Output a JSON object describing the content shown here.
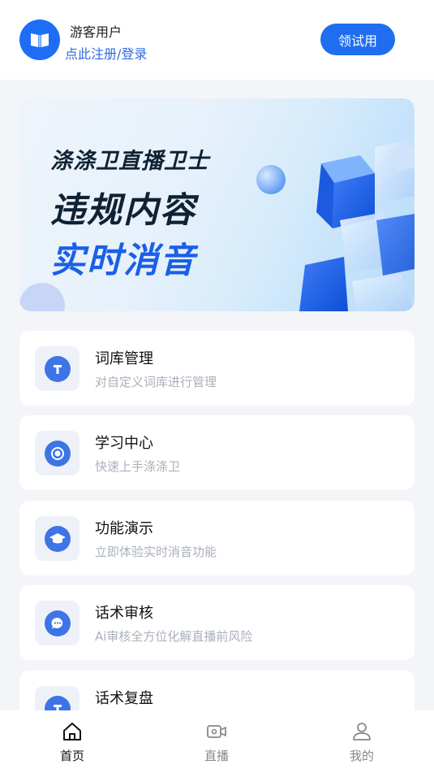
{
  "header": {
    "user_name": "游客用户",
    "login_link": "点此注册/登录",
    "trial_button": "领试用",
    "avatar_icon": "book-icon"
  },
  "banner": {
    "title": "涤涤卫直播卫士",
    "line1": "违规内容",
    "line2": "实时消音"
  },
  "menu": [
    {
      "title": "词库管理",
      "desc": "对自定义词库进行管理",
      "icon": "t-letter-icon"
    },
    {
      "title": "学习中心",
      "desc": "快速上手涤涤卫",
      "icon": "target-icon"
    },
    {
      "title": "功能演示",
      "desc": "立即体验实时消音功能",
      "icon": "graduation-cap-icon"
    },
    {
      "title": "话术审核",
      "desc": "Ai审核全方位化解直播前风险",
      "icon": "chat-bubble-icon"
    },
    {
      "title": "话术复盘",
      "desc": "",
      "icon": "t-letter-icon"
    }
  ],
  "tabbar": [
    {
      "label": "首页",
      "icon": "home-icon",
      "active": true
    },
    {
      "label": "直播",
      "icon": "video-camera-icon",
      "active": false
    },
    {
      "label": "我的",
      "icon": "user-icon",
      "active": false
    }
  ],
  "colors": {
    "accent": "#1f6ef0",
    "link": "#2f6bdc",
    "icon": "#3d74e6"
  }
}
